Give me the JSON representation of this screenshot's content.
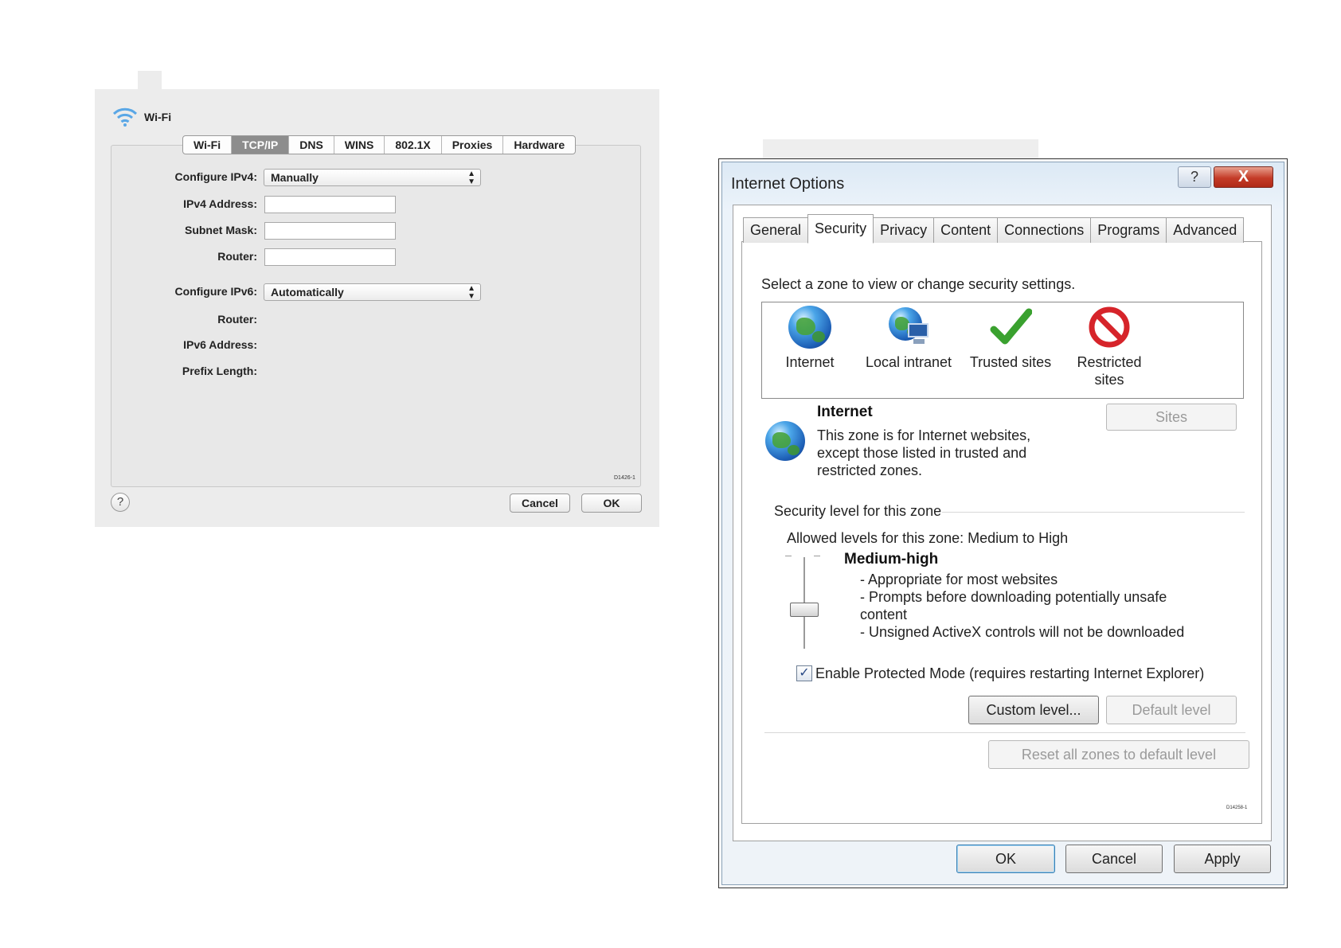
{
  "mac": {
    "title": "Wi-Fi",
    "tabs": [
      {
        "label": "Wi-Fi",
        "active": false
      },
      {
        "label": "TCP/IP",
        "active": true
      },
      {
        "label": "DNS",
        "active": false
      },
      {
        "label": "WINS",
        "active": false
      },
      {
        "label": "802.1X",
        "active": false
      },
      {
        "label": "Proxies",
        "active": false
      },
      {
        "label": "Hardware",
        "active": false
      }
    ],
    "configure_ipv4_label": "Configure IPv4:",
    "configure_ipv4_value": "Manually",
    "ipv4_address_label": "IPv4 Address:",
    "ipv4_address_value": "",
    "subnet_mask_label": "Subnet Mask:",
    "subnet_mask_value": "",
    "router_label": "Router:",
    "router_value": "",
    "configure_ipv6_label": "Configure IPv6:",
    "configure_ipv6_value": "Automatically",
    "router6_label": "Router:",
    "ipv6_address_label": "IPv6 Address:",
    "prefix_length_label": "Prefix Length:",
    "help_label": "?",
    "cancel_label": "Cancel",
    "ok_label": "OK",
    "figure_code": "D1426-1"
  },
  "win": {
    "title": "Internet Options",
    "help_glyph": "?",
    "close_glyph": "X",
    "tabs": [
      {
        "label": "General",
        "active": false
      },
      {
        "label": "Security",
        "active": true
      },
      {
        "label": "Privacy",
        "active": false
      },
      {
        "label": "Content",
        "active": false
      },
      {
        "label": "Connections",
        "active": false
      },
      {
        "label": "Programs",
        "active": false
      },
      {
        "label": "Advanced",
        "active": false
      }
    ],
    "zone_prompt": "Select a zone to view or change security settings.",
    "zones": [
      {
        "label": "Internet",
        "icon": "globe-icon"
      },
      {
        "label": "Local intranet",
        "icon": "intranet-icon"
      },
      {
        "label": "Trusted sites",
        "icon": "checkmark-icon"
      },
      {
        "label": "Restricted sites",
        "icon": "restricted-icon"
      }
    ],
    "selected_zone_title": "Internet",
    "selected_zone_desc_1": "This zone is for Internet websites,",
    "selected_zone_desc_2": "except those listed in trusted and",
    "selected_zone_desc_3": "restricted zones.",
    "sites_label": "Sites",
    "security_level_heading": "Security level for this zone",
    "allowed_levels": "Allowed levels for this zone: Medium to High",
    "level_name": "Medium-high",
    "level_bullets": [
      "- Appropriate for most websites",
      "- Prompts before downloading potentially unsafe",
      "content",
      "- Unsigned ActiveX controls will not be downloaded"
    ],
    "protected_mode_label": "Enable Protected Mode (requires restarting Internet Explorer)",
    "protected_mode_checked": true,
    "custom_level_label": "Custom level...",
    "default_level_label": "Default level",
    "reset_all_label": "Reset all zones to default level",
    "figure_code": "D14258-1",
    "ok_label": "OK",
    "cancel_label": "Cancel",
    "apply_label": "Apply"
  }
}
